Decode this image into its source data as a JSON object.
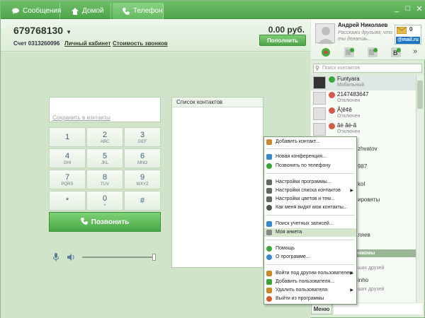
{
  "titlebar": {
    "tabs": [
      {
        "label": "Сообщения",
        "icon": "chat-bubble-icon"
      },
      {
        "label": "Домой",
        "icon": "home-icon"
      },
      {
        "label": "Телефон",
        "icon": "phone-icon"
      }
    ],
    "minimize": "_",
    "maximize": "□",
    "close": "✕"
  },
  "account": {
    "phone_number": "679768130",
    "account_label": "Счет 0313260096",
    "cabinet_link": "Личный кабинет",
    "rates_link": "Стоимость звонков",
    "balance": "0.00 руб.",
    "topup_label": "Пополнить"
  },
  "dialer": {
    "number_value": "",
    "save_contact": "Сохранить в контакты",
    "keys": [
      {
        "digit": "1",
        "letters": ""
      },
      {
        "digit": "2",
        "letters": "ABC"
      },
      {
        "digit": "3",
        "letters": "DEF"
      },
      {
        "digit": "4",
        "letters": "GHI"
      },
      {
        "digit": "5",
        "letters": "JKL"
      },
      {
        "digit": "6",
        "letters": "MNO"
      },
      {
        "digit": "7",
        "letters": "PQRS"
      },
      {
        "digit": "8",
        "letters": "TUV"
      },
      {
        "digit": "9",
        "letters": "WXYZ"
      },
      {
        "digit": "*",
        "letters": ""
      },
      {
        "digit": "0",
        "letters": "+"
      },
      {
        "digit": "#",
        "letters": ""
      }
    ],
    "call_label": "Позвонить",
    "volume_level": 1.0
  },
  "contacts_panel": {
    "title": "Список контактов"
  },
  "profile": {
    "name": "Андрей Николаев",
    "status_placeholder": "Расскажи друзьям, что ты делаешь...",
    "mail_count": "0",
    "mail_logo": "@mail.ru"
  },
  "search": {
    "placeholder": "Поиск контактов"
  },
  "contacts": [
    {
      "name": "Funtyara",
      "status": "Мобильный",
      "state_color": "#3aa63a",
      "selected": true
    },
    {
      "name": "2147483647",
      "status": "Отключен",
      "state_color": "#d25a4c",
      "selected": false
    },
    {
      "name": "Ã¦ê¢ê",
      "status": "Отключен",
      "state_color": "#d25a4c",
      "selected": false
    },
    {
      "name": "ãè ãè-ã",
      "status": "Отключен",
      "state_color": "#d25a4c",
      "selected": false
    }
  ],
  "partial_list_text": {
    "t1": "zhvatov",
    "t2": "987",
    "t3": "kol",
    "t4": "ировяты",
    "t5": "ляев",
    "group": "знакомы",
    "t6": "ших друзей",
    "t7": "inho",
    "t8": "ших друзей"
  },
  "menu_button": "Меню",
  "context_menu": {
    "items": [
      {
        "label": "Добавить контакт...",
        "icon": "add-contact-icon",
        "color": "#c98a2e",
        "submenu": false
      },
      {
        "label": "Новая конференция...",
        "icon": "conference-icon",
        "color": "#3a86c8",
        "submenu": false
      },
      {
        "label": "Позвонить по телефону",
        "icon": "phone-call-icon",
        "color": "#3aa63a",
        "submenu": false
      },
      {
        "label": "Настройки программы...",
        "icon": "settings-icon",
        "color": "#666666",
        "submenu": false
      },
      {
        "label": "Настройки списка контактов",
        "icon": "list-settings-icon",
        "color": "#666666",
        "submenu": true
      },
      {
        "label": "Настройки цветов и тем...",
        "icon": "theme-icon",
        "color": "#666666",
        "submenu": false
      },
      {
        "label": "Как меня видят мои контакты...",
        "icon": "eye-icon",
        "color": "#555555",
        "submenu": false
      },
      {
        "label": "Поиск учетных записей...",
        "icon": "search-accounts-icon",
        "color": "#3a86c8",
        "submenu": false
      },
      {
        "label": "Моя анкета",
        "icon": "profile-card-icon",
        "color": "#888888",
        "submenu": false
      },
      {
        "label": "Помощь",
        "icon": "help-icon",
        "color": "#3aa63a",
        "submenu": false
      },
      {
        "label": "О программе...",
        "icon": "about-icon",
        "color": "#3a86c8",
        "submenu": false
      },
      {
        "label": "Войти под другим пользователем",
        "icon": "switch-user-icon",
        "color": "#c98a2e",
        "submenu": true
      },
      {
        "label": "Добавить пользователя...",
        "icon": "add-user-icon",
        "color": "#3aa63a",
        "submenu": false
      },
      {
        "label": "Удалить пользователя",
        "icon": "remove-user-icon",
        "color": "#c98a2e",
        "submenu": true
      },
      {
        "label": "Выйти из программы",
        "icon": "exit-icon",
        "color": "#d25a2c",
        "submenu": false
      }
    ]
  }
}
